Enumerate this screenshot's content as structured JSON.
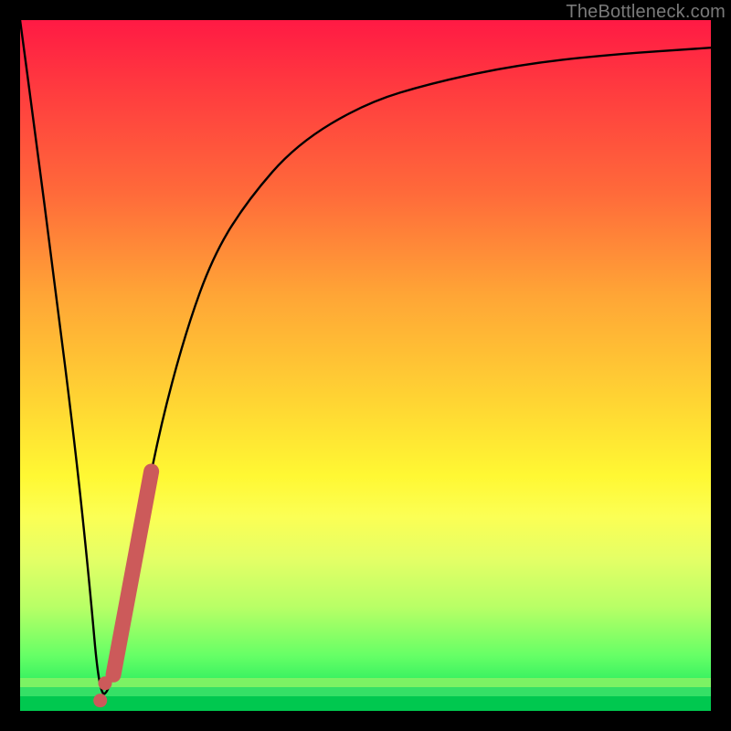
{
  "watermark": "TheBottleneck.com",
  "chart_data": {
    "type": "line",
    "xlabel": "",
    "ylabel": "",
    "xlim": [
      0,
      100
    ],
    "ylim": [
      0,
      100
    ],
    "series": [
      {
        "name": "bottleneck-curve",
        "x": [
          0,
          2,
          5,
          8,
          10,
          11.5,
          13,
          15,
          17,
          20,
          24,
          28,
          33,
          40,
          50,
          60,
          72,
          85,
          100
        ],
        "y": [
          100,
          85,
          62,
          38,
          19,
          2,
          3,
          12,
          24,
          40,
          55,
          66,
          74,
          82,
          88,
          91,
          93.5,
          95,
          96
        ]
      }
    ],
    "annotations": {
      "highlight_segment": {
        "x_start": 13.5,
        "x_end": 19,
        "series": "bottleneck-curve"
      },
      "highlight_points": [
        {
          "x": 12.3,
          "y": 4
        },
        {
          "x": 11.6,
          "y": 1.5
        }
      ]
    },
    "background": {
      "gradient": "green-to-red-vertical",
      "meaning": "low-y=good, high-y=bad"
    }
  }
}
